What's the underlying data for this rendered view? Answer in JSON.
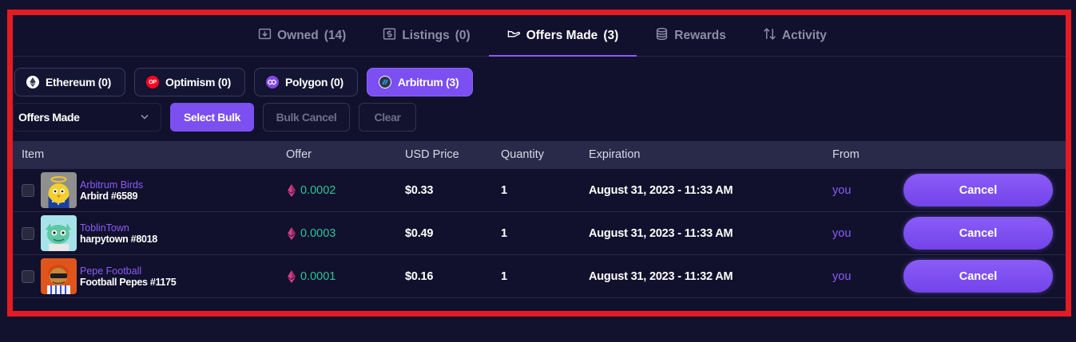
{
  "tabs": [
    {
      "icon": "download-box-icon",
      "label": "Owned",
      "count": "(14)"
    },
    {
      "icon": "dollar-box-icon",
      "label": "Listings",
      "count": "(0)"
    },
    {
      "icon": "hand-icon",
      "label": "Offers Made",
      "count": "(3)",
      "active": true
    },
    {
      "icon": "coins-icon",
      "label": "Rewards",
      "count": ""
    },
    {
      "icon": "arrows-up-down-icon",
      "label": "Activity",
      "count": ""
    }
  ],
  "chains": [
    {
      "label": "Ethereum (0)",
      "icon": "ethereum-icon",
      "color": "#ffffff"
    },
    {
      "label": "Optimism (0)",
      "icon": "optimism-icon",
      "color": "#ff0420",
      "badge": "OP"
    },
    {
      "label": "Polygon (0)",
      "icon": "polygon-icon",
      "color": "#8247e5"
    },
    {
      "label": "Arbitrum (3)",
      "icon": "arbitrum-icon",
      "color": "#28a0f0"
    }
  ],
  "controls": {
    "select_value": "Offers Made",
    "select_bulk": "Select Bulk",
    "bulk_cancel": "Bulk Cancel",
    "clear": "Clear"
  },
  "table": {
    "headers": {
      "item": "Item",
      "offer": "Offer",
      "usd": "USD Price",
      "qty": "Quantity",
      "expiration": "Expiration",
      "from": "From"
    },
    "rows": [
      {
        "collection": "Arbitrum Birds",
        "name": "Arbird #6589",
        "offer": "0.0002",
        "usd": "$0.33",
        "qty": "1",
        "expiration": "August 31, 2023 - 11:33 AM",
        "from": "you",
        "action": "Cancel"
      },
      {
        "collection": "ToblinTown",
        "name": "harpytown #8018",
        "offer": "0.0003",
        "usd": "$0.49",
        "qty": "1",
        "expiration": "August 31, 2023 - 11:33 AM",
        "from": "you",
        "action": "Cancel"
      },
      {
        "collection": "Pepe Football",
        "name": "Football Pepes #1175",
        "offer": "0.0001",
        "usd": "$0.16",
        "qty": "1",
        "expiration": "August 31, 2023 - 11:32 AM",
        "from": "you",
        "action": "Cancel"
      }
    ]
  },
  "colors": {
    "accent": "#7b4ff0",
    "offer_green": "#2bc59a",
    "frame_red": "#e41b23",
    "background": "#12122e"
  }
}
